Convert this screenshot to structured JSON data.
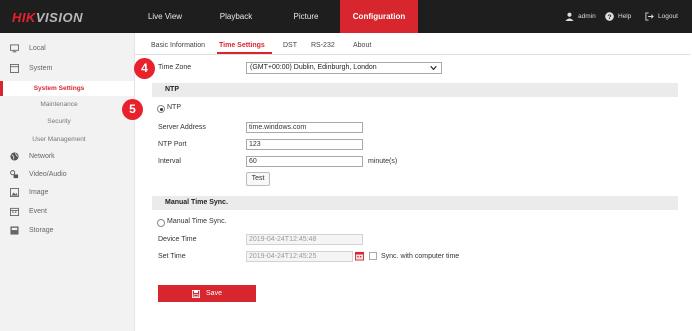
{
  "brand": {
    "hik": "HIK",
    "vision": "VISION"
  },
  "nav": [
    {
      "label": "Live View"
    },
    {
      "label": "Playback"
    },
    {
      "label": "Picture"
    },
    {
      "label": "Configuration"
    }
  ],
  "topright": {
    "user": "admin",
    "help": "Help",
    "logout": "Logout"
  },
  "sidebar": {
    "local": "Local",
    "system": "System",
    "system_settings": "System Settings",
    "maintenance": "Maintenance",
    "security": "Security",
    "user_management": "User Management",
    "network": "Network",
    "video_audio": "Video/Audio",
    "image": "Image",
    "event": "Event",
    "storage": "Storage"
  },
  "tabs": [
    {
      "label": "Basic Information"
    },
    {
      "label": "Time Settings"
    },
    {
      "label": "DST"
    },
    {
      "label": "RS-232"
    },
    {
      "label": "About"
    }
  ],
  "steps": {
    "four": "4",
    "five": "5"
  },
  "form": {
    "time_zone_label": "Time Zone",
    "time_zone_value": "(GMT+00:00) Dublin, Edinburgh, London",
    "ntp_section": "NTP",
    "ntp_radio": "NTP",
    "server_address_label": "Server Address",
    "server_address_value": "time.windows.com",
    "ntp_port_label": "NTP Port",
    "ntp_port_value": "123",
    "interval_label": "Interval",
    "interval_value": "60",
    "interval_unit": "minute(s)",
    "test_button": "Test",
    "manual_section": "Manual Time Sync.",
    "manual_radio": "Manual Time Sync.",
    "device_time_label": "Device Time",
    "device_time_value": "2019-04-24T12:45:48",
    "set_time_label": "Set Time",
    "set_time_value": "2019-04-24T12:45:25",
    "sync_label": "Sync. with computer time",
    "save_button": "Save"
  },
  "colors": {
    "accent": "#d8262e",
    "topbar": "#1e1e1e"
  }
}
